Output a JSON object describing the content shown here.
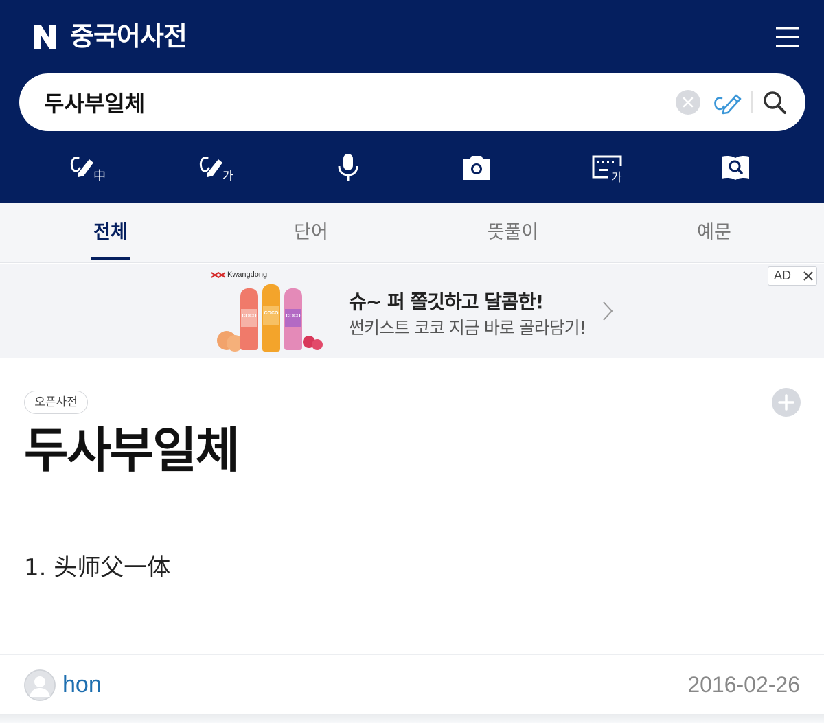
{
  "header": {
    "logo_text": "N",
    "title": "중국어사전",
    "menu_icon": "hamburger-menu-icon"
  },
  "search": {
    "value": "두사부일체",
    "clear_icon": "close-circle-icon",
    "handwrite_icon": "handwriting-pen-icon",
    "search_icon": "magnifier-icon"
  },
  "tools": [
    {
      "name": "chinese-handwriting-icon",
      "glyph": "中"
    },
    {
      "name": "korean-handwriting-icon",
      "glyph": "가"
    },
    {
      "name": "microphone-icon",
      "glyph": ""
    },
    {
      "name": "camera-icon",
      "glyph": ""
    },
    {
      "name": "korean-keyboard-icon",
      "glyph": "가"
    },
    {
      "name": "dictionary-search-icon",
      "glyph": ""
    }
  ],
  "tabs": [
    {
      "label": "전체",
      "active": true
    },
    {
      "label": "단어",
      "active": false
    },
    {
      "label": "뜻풀이",
      "active": false
    },
    {
      "label": "예문",
      "active": false
    }
  ],
  "ad": {
    "brand": "Kwangdong",
    "bottle_labels": [
      "COCO",
      "COCO",
      "COCO"
    ],
    "title": "슈~ 퍼 쫄깃하고 달콤한!",
    "description": "썬키스트 코코 지금 바로 골라담기!",
    "badge": "AD",
    "arrow_icon": "chevron-right-icon",
    "close_icon": "close-icon"
  },
  "entry": {
    "source_tag": "오픈사전",
    "title": "두사부일체",
    "meaning": "1. 头师父一体",
    "add_icon": "plus-icon"
  },
  "footer": {
    "author": "hon",
    "date": "2016-02-26",
    "avatar_icon": "user-avatar-icon"
  },
  "colors": {
    "header_bg": "#051f5f",
    "tab_active": "#051f5f",
    "author_link": "#1e6fb0"
  }
}
